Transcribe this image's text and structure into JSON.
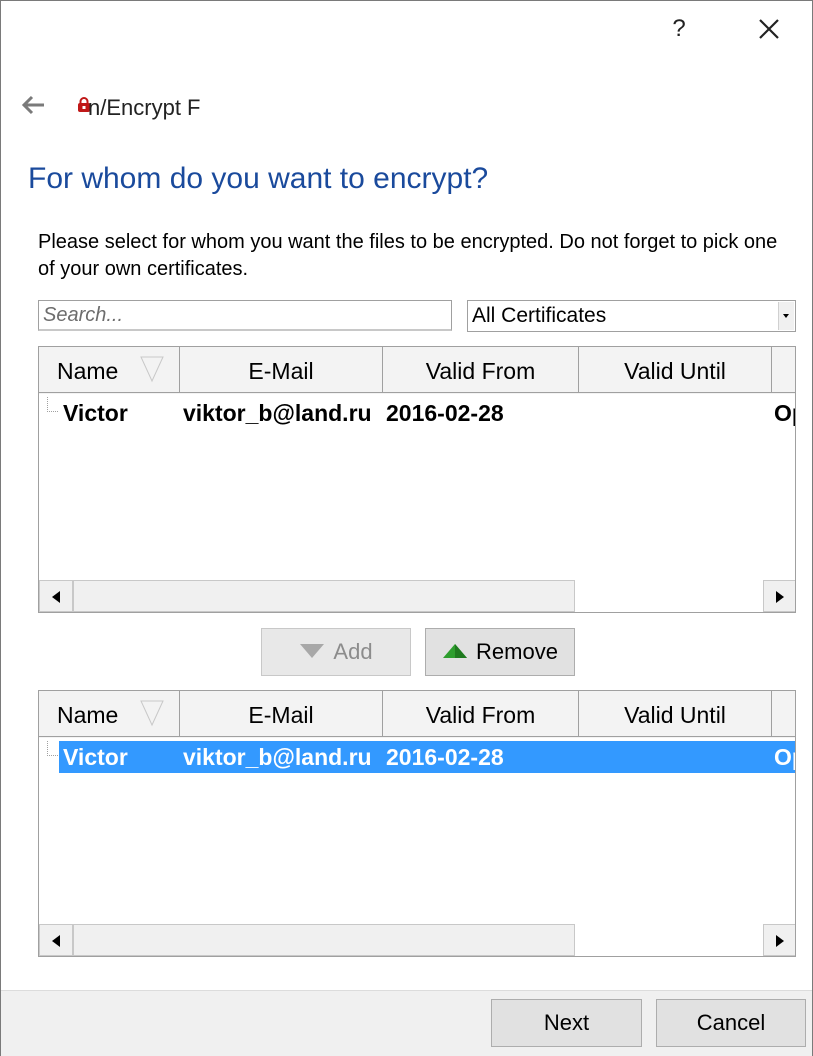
{
  "titlebar": {
    "help_label": "?"
  },
  "header": {
    "app_title": "n/Encrypt F"
  },
  "heading": "For whom do you want to encrypt?",
  "instructions": "Please select for whom you want the files to be encrypted. Do not forget to pick one of your own certificates.",
  "search": {
    "placeholder": "Search...",
    "value": ""
  },
  "filter": {
    "selected": "All Certificates"
  },
  "columns": {
    "name": "Name",
    "email": "E-Mail",
    "valid_from": "Valid From",
    "valid_until": "Valid Until"
  },
  "available": {
    "rows": [
      {
        "name": "Victor",
        "email": "viktor_b@land.ru",
        "valid_from": "2016-02-28",
        "valid_until": "",
        "extra": "Op"
      }
    ]
  },
  "actions": {
    "add_label": "Add",
    "remove_label": "Remove"
  },
  "selected_list": {
    "rows": [
      {
        "name": "Victor",
        "email": "viktor_b@land.ru",
        "valid_from": "2016-02-28",
        "valid_until": "",
        "extra": "Op",
        "selected": true
      }
    ]
  },
  "footer": {
    "next_label": "Next",
    "cancel_label": "Cancel"
  },
  "colors": {
    "heading": "#1a4a9c",
    "selection": "#3399ff",
    "remove_icon": "#2e9e2e"
  }
}
